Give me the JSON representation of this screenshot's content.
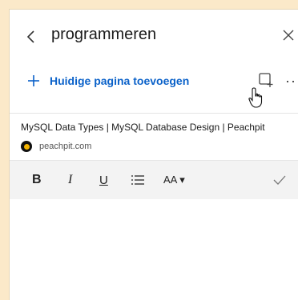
{
  "header": {
    "title": "programmeren",
    "add_label": "Huidige pagina toevoegen",
    "more_label": "···"
  },
  "card": {
    "page_title": "MySQL Data Types | MySQL Database Design | Peachpit",
    "site": "peachpit.com"
  },
  "toolbar": {
    "bold": "B",
    "italic": "I",
    "underline": "U",
    "font_size": "AA ▾"
  },
  "icons": {
    "back": "chevron-left-icon",
    "close": "close-icon",
    "add": "plus-icon",
    "add_note": "add-note-icon",
    "more": "more-horizontal-icon",
    "favicon": "peachpit-favicon-icon",
    "list": "bulleted-list-icon",
    "check": "checkmark-icon"
  },
  "colors": {
    "accent": "#0a61c9",
    "background": "#fbe9c9",
    "panel": "#f7f7f7"
  }
}
